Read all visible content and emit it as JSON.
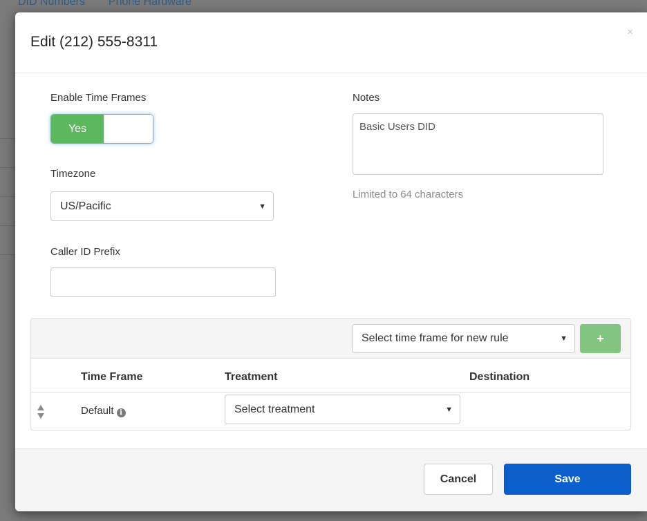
{
  "background": {
    "tabs": [
      "DID Numbers",
      "Phone Hardware"
    ]
  },
  "modal": {
    "title": "Edit (212) 555-8311",
    "close_symbol": "×"
  },
  "form": {
    "enable_time_frames": {
      "label": "Enable Time Frames",
      "value": "Yes",
      "enabled": true
    },
    "timezone": {
      "label": "Timezone",
      "selected": "US/Pacific"
    },
    "caller_id_prefix": {
      "label": "Caller ID Prefix",
      "value": ""
    },
    "notes": {
      "label": "Notes",
      "value": "Basic Users DID",
      "help": "Limited to 64 characters"
    }
  },
  "rules": {
    "new_rule_select": {
      "selected": "Select time frame for new rule"
    },
    "add_button_symbol": "+",
    "columns": [
      "Time Frame",
      "Treatment",
      "Destination"
    ],
    "rows": [
      {
        "time_frame": "Default",
        "treatment_placeholder": "Select treatment",
        "destination": ""
      }
    ]
  },
  "footer": {
    "cancel_label": "Cancel",
    "save_label": "Save"
  },
  "colors": {
    "toggle_on": "#5cb85c",
    "save_button": "#0a5fcc",
    "add_button": "#82c582"
  }
}
